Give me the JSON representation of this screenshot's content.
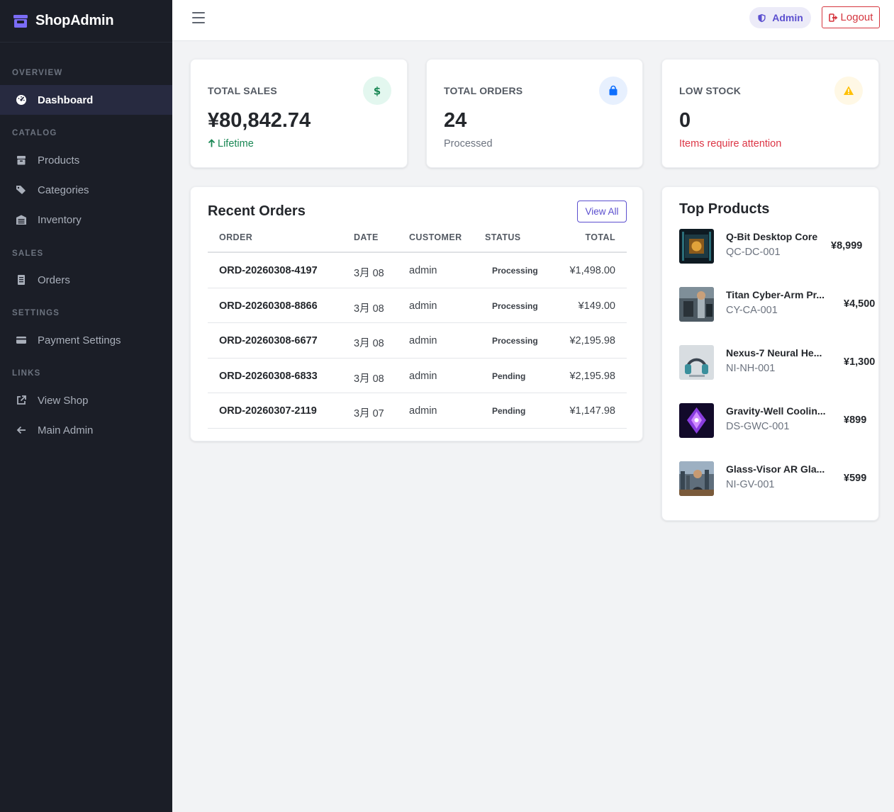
{
  "brand": {
    "name": "ShopAdmin"
  },
  "sidebar": {
    "sections": [
      {
        "label": "OVERVIEW"
      },
      {
        "label": "CATALOG"
      },
      {
        "label": "SALES"
      },
      {
        "label": "SETTINGS"
      },
      {
        "label": "LINKS"
      }
    ],
    "items": [
      {
        "label": "Dashboard",
        "icon": "gauge-icon",
        "active": true
      },
      {
        "label": "Products",
        "icon": "box-icon"
      },
      {
        "label": "Categories",
        "icon": "tags-icon"
      },
      {
        "label": "Inventory",
        "icon": "warehouse-icon"
      },
      {
        "label": "Orders",
        "icon": "receipt-icon"
      },
      {
        "label": "Payment Settings",
        "icon": "credit-card-icon"
      },
      {
        "label": "View Shop",
        "icon": "external-link-icon"
      },
      {
        "label": "Main Admin",
        "icon": "arrow-left-icon"
      }
    ]
  },
  "topbar": {
    "user_label": "Admin",
    "logout_label": "Logout"
  },
  "stats": [
    {
      "label": "TOTAL SALES",
      "value": "¥80,842.74",
      "sub": "Lifetime",
      "sub_color": "#198754",
      "icon": "dollar-icon",
      "icon_color": "#198754",
      "icon_bg": "#e3f7ef"
    },
    {
      "label": "TOTAL ORDERS",
      "value": "24",
      "sub": "Processed",
      "sub_color": "#6c737f",
      "icon": "shopping-bag-icon",
      "icon_color": "#0d6efd",
      "icon_bg": "#e7f0fe"
    },
    {
      "label": "LOW STOCK",
      "value": "0",
      "sub": "Items require attention",
      "sub_color": "#dc3545",
      "icon": "warning-icon",
      "icon_color": "#ffc107",
      "icon_bg": "#fff8e5"
    }
  ],
  "recent_orders": {
    "title": "Recent Orders",
    "view_all_label": "View All",
    "columns": [
      "ORDER",
      "DATE",
      "CUSTOMER",
      "STATUS",
      "TOTAL"
    ],
    "rows": [
      {
        "order": "ORD-20260308-4197",
        "date": "3月 08",
        "customer": "admin",
        "status": "Processing",
        "total": "¥1,498.00"
      },
      {
        "order": "ORD-20260308-8866",
        "date": "3月 08",
        "customer": "admin",
        "status": "Processing",
        "total": "¥149.00"
      },
      {
        "order": "ORD-20260308-6677",
        "date": "3月 08",
        "customer": "admin",
        "status": "Processing",
        "total": "¥2,195.98"
      },
      {
        "order": "ORD-20260308-6833",
        "date": "3月 08",
        "customer": "admin",
        "status": "Pending",
        "total": "¥2,195.98"
      },
      {
        "order": "ORD-20260307-2119",
        "date": "3月 07",
        "customer": "admin",
        "status": "Pending",
        "total": "¥1,147.98"
      }
    ]
  },
  "top_products": {
    "title": "Top Products",
    "items": [
      {
        "name": "Q-Bit Desktop Core",
        "sku": "QC-DC-001",
        "price": "¥8,999"
      },
      {
        "name": "Titan Cyber-Arm Pr...",
        "sku": "CY-CA-001",
        "price": "¥4,500"
      },
      {
        "name": "Nexus-7 Neural He...",
        "sku": "NI-NH-001",
        "price": "¥1,300"
      },
      {
        "name": "Gravity-Well Coolin...",
        "sku": "DS-GWC-001",
        "price": "¥899"
      },
      {
        "name": "Glass-Visor AR Gla...",
        "sku": "NI-GV-001",
        "price": "¥599"
      }
    ]
  }
}
